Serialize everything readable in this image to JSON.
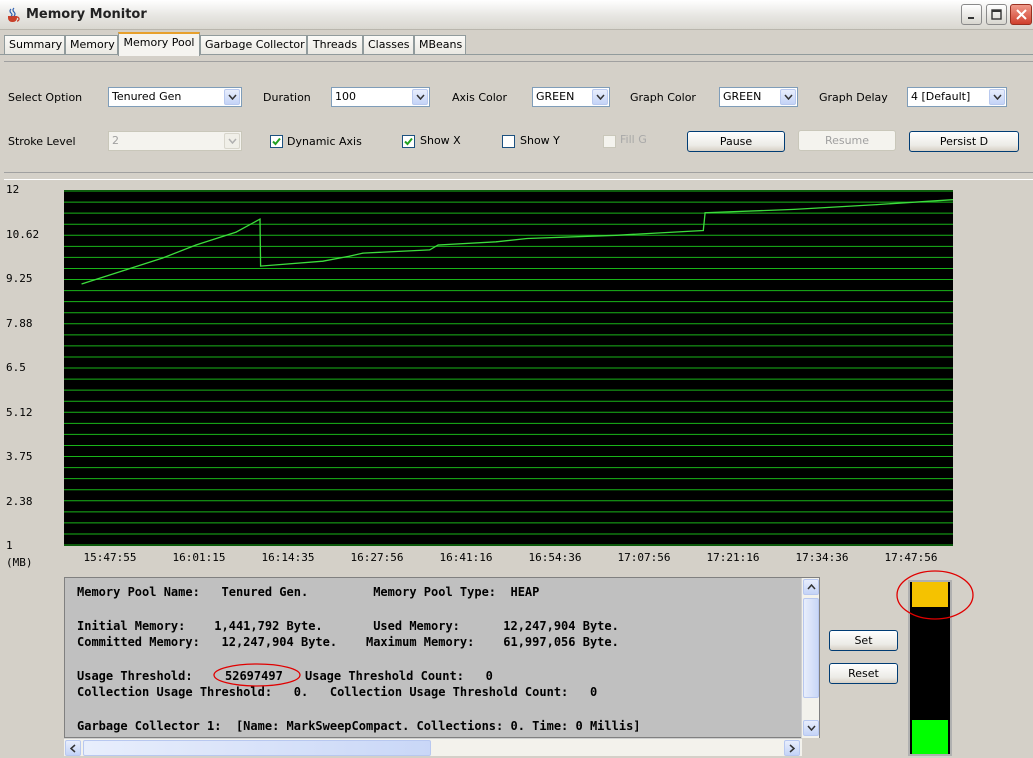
{
  "window": {
    "title": "Memory Monitor",
    "app_icon": "java-coffee-cup-icon",
    "controls": [
      "minimize-icon",
      "maximize-icon",
      "close-icon"
    ]
  },
  "tabs": [
    {
      "label": "Summary",
      "active": false
    },
    {
      "label": "Memory",
      "active": false
    },
    {
      "label": "Memory Pool",
      "active": true
    },
    {
      "label": "Garbage Collector",
      "active": false
    },
    {
      "label": "Threads",
      "active": false
    },
    {
      "label": "Classes",
      "active": false
    },
    {
      "label": "MBeans",
      "active": false
    }
  ],
  "controls": {
    "select_option": {
      "label": "Select Option",
      "value": "Tenured Gen"
    },
    "duration": {
      "label": "Duration",
      "value": "100"
    },
    "axis_color": {
      "label": "Axis Color",
      "value": "GREEN"
    },
    "graph_color": {
      "label": "Graph Color",
      "value": "GREEN"
    },
    "graph_delay": {
      "label": "Graph Delay",
      "value": "4 [Default]"
    },
    "stroke_level": {
      "label": "Stroke Level",
      "value": "2",
      "disabled": true
    },
    "dynamic_axis": {
      "label": "Dynamic Axis",
      "checked": true
    },
    "show_x": {
      "label": "Show X",
      "checked": true
    },
    "show_y": {
      "label": "Show Y",
      "checked": false
    },
    "fill_g": {
      "label": "Fill G",
      "checked": false,
      "disabled": true
    },
    "pause": "Pause",
    "resume": "Resume",
    "persist": "Persist D"
  },
  "chart_data": {
    "type": "line",
    "ylabel": "(MB)",
    "ylim": [
      1,
      12
    ],
    "y_ticks": [
      "12",
      "10.62",
      "9.25",
      "7.88",
      "6.5",
      "5.12",
      "3.75",
      "2.38",
      "1"
    ],
    "x_ticks": [
      "15:47:55",
      "16:01:15",
      "16:14:35",
      "16:27:56",
      "16:41:16",
      "16:54:36",
      "17:07:56",
      "17:21:16",
      "17:34:36",
      "17:47:56"
    ],
    "background": "#000000",
    "grid": true,
    "grid_color": "#19b419",
    "line_color": "#3ddc3d",
    "series": [
      {
        "x": [
          "15:47:55",
          "15:54:00",
          "16:00:00",
          "16:05:00",
          "16:11:00",
          "16:14:35",
          "16:14:40",
          "16:24:00",
          "16:27:56",
          "16:30:00",
          "16:40:00",
          "16:41:16",
          "16:50:00",
          "16:54:36",
          "17:07:56",
          "17:21:00",
          "17:21:16",
          "17:34:36",
          "17:47:00",
          "17:53:00"
        ],
        "values": [
          9.1,
          9.5,
          9.9,
          10.3,
          10.7,
          11.1,
          9.65,
          9.8,
          9.95,
          10.05,
          10.15,
          10.3,
          10.4,
          10.5,
          10.6,
          10.75,
          11.3,
          11.4,
          11.55,
          11.7
        ]
      }
    ]
  },
  "info_panel": {
    "lines": [
      "Memory Pool Name:   Tenured Gen.         Memory Pool Type:  HEAP",
      "",
      "Initial Memory:    1,441,792 Byte.       Used Memory:      12,247,904 Byte.",
      "Committed Memory:   12,247,904 Byte.    Maximum Memory:    61,997,056 Byte.",
      "",
      "Usage Threshold:",
      "Collection Usage Threshold:   0.   Collection Usage Threshold Count:   0",
      "",
      "Garbage Collector 1:  [Name: MarkSweepCompact. Collections: 0. Time: 0 Millis]"
    ],
    "usage_threshold": "52697497",
    "usage_threshold_count_text": "Usage Threshold Count:   0"
  },
  "threshold_buttons": {
    "set": "Set",
    "reset": "Reset"
  },
  "gauge": {
    "used_fraction": 0.2,
    "top_color": "#f5c200",
    "bottom_color": "#00ff00",
    "annotation_color": "#e00000"
  }
}
